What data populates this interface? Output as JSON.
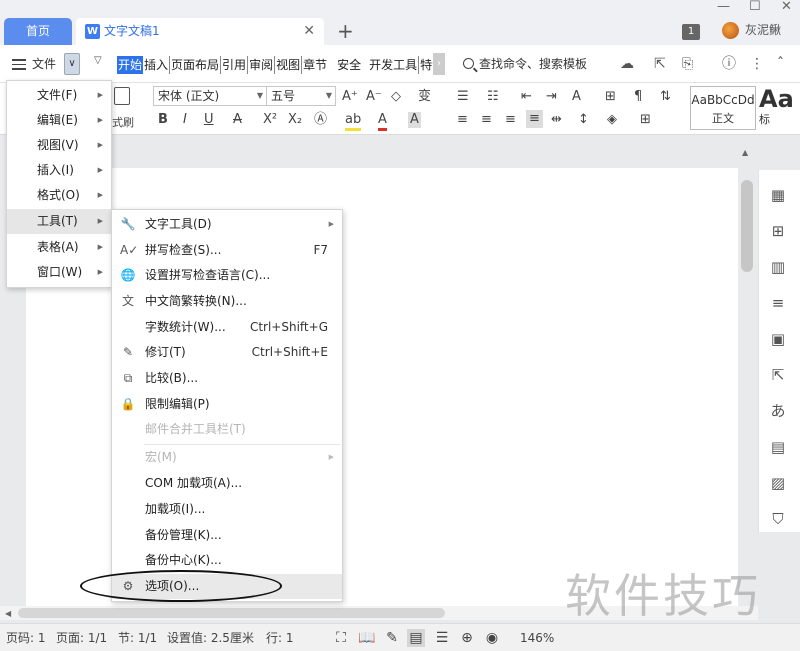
{
  "titlebar": {
    "home_tab": "首页",
    "doc_icon": "W",
    "doc_tab": "文字文稿1",
    "close": "✕",
    "add": "+",
    "badge": "1",
    "username": "灰泥鳅",
    "win_minimize": "—",
    "win_maximize": "☐",
    "win_close": "✕"
  },
  "toolbar": {
    "menu_label": "文件",
    "file_dropdown": "∨",
    "quick_dropdown": "▽",
    "tabs": [
      "开始",
      "插入",
      "页面布局",
      "引用",
      "审阅",
      "视图",
      "章节",
      "安全",
      "开发工具",
      "特色"
    ],
    "tab_more": "›",
    "search_label": "查找命令、搜索模板",
    "icons": [
      "cloud-icon",
      "share-icon",
      "export-icon",
      "help-icon",
      "more-icon",
      "collapse-icon"
    ]
  },
  "ribbon": {
    "font_name": "宋体 (正文)",
    "font_size": "五号",
    "format_painter": "式刷",
    "style1_sample": "AaBbCcDd",
    "style1_name": "正文",
    "style2_sample": "Aa",
    "style2_name": "标"
  },
  "menu_main": {
    "items": [
      {
        "label": "文件(F)"
      },
      {
        "label": "编辑(E)"
      },
      {
        "label": "视图(V)"
      },
      {
        "label": "插入(I)"
      },
      {
        "label": "格式(O)"
      },
      {
        "label": "工具(T)"
      },
      {
        "label": "表格(A)"
      },
      {
        "label": "窗口(W)"
      }
    ],
    "active_index": 5
  },
  "menu_tools": {
    "items": [
      {
        "label": "文字工具(D)",
        "shortcut": "",
        "icon": "wrench-icon",
        "submenu": true,
        "disabled": false
      },
      {
        "label": "拼写检查(S)...",
        "shortcut": "F7",
        "icon": "spellcheck-icon",
        "submenu": false,
        "disabled": false
      },
      {
        "label": "设置拼写检查语言(C)...",
        "shortcut": "",
        "icon": "language-icon",
        "submenu": false,
        "disabled": false
      },
      {
        "label": "中文简繁转换(N)...",
        "shortcut": "",
        "icon": "convert-icon",
        "submenu": false,
        "disabled": false
      },
      {
        "label": "字数统计(W)...",
        "shortcut": "Ctrl+Shift+G",
        "icon": "",
        "submenu": false,
        "disabled": false
      },
      {
        "label": "修订(T)",
        "shortcut": "Ctrl+Shift+E",
        "icon": "revision-icon",
        "submenu": false,
        "disabled": false
      },
      {
        "label": "比较(B)...",
        "shortcut": "",
        "icon": "compare-icon",
        "submenu": false,
        "disabled": false
      },
      {
        "label": "限制编辑(P)",
        "shortcut": "",
        "icon": "restrict-icon",
        "submenu": false,
        "disabled": false
      },
      {
        "label": "邮件合并工具栏(T)",
        "shortcut": "",
        "icon": "",
        "submenu": false,
        "disabled": true
      },
      {
        "label": "宏(M)",
        "shortcut": "",
        "icon": "",
        "submenu": true,
        "disabled": true
      },
      {
        "label": "COM 加载项(A)...",
        "shortcut": "",
        "icon": "",
        "submenu": false,
        "disabled": false
      },
      {
        "label": "加载项(I)...",
        "shortcut": "",
        "icon": "",
        "submenu": false,
        "disabled": false
      },
      {
        "label": "备份管理(K)...",
        "shortcut": "",
        "icon": "",
        "submenu": false,
        "disabled": false
      },
      {
        "label": "备份中心(K)...",
        "shortcut": "",
        "icon": "",
        "submenu": false,
        "disabled": false
      },
      {
        "label": "选项(O)...",
        "shortcut": "",
        "icon": "gear-icon",
        "submenu": false,
        "disabled": false
      }
    ],
    "hover_index": 14
  },
  "statusbar": {
    "page_no": "页码: 1",
    "page_total": "页面: 1/1",
    "section": "节: 1/1",
    "settings": "设置值: 2.5厘米",
    "line": "行: 1",
    "zoom": "146%"
  },
  "watermark": "软件技巧",
  "colors": {
    "accent": "#2c72e8",
    "home_tab": "#5b8def",
    "menu_hover": "#e6e6e6",
    "disabled_text": "#b5b5b5"
  }
}
